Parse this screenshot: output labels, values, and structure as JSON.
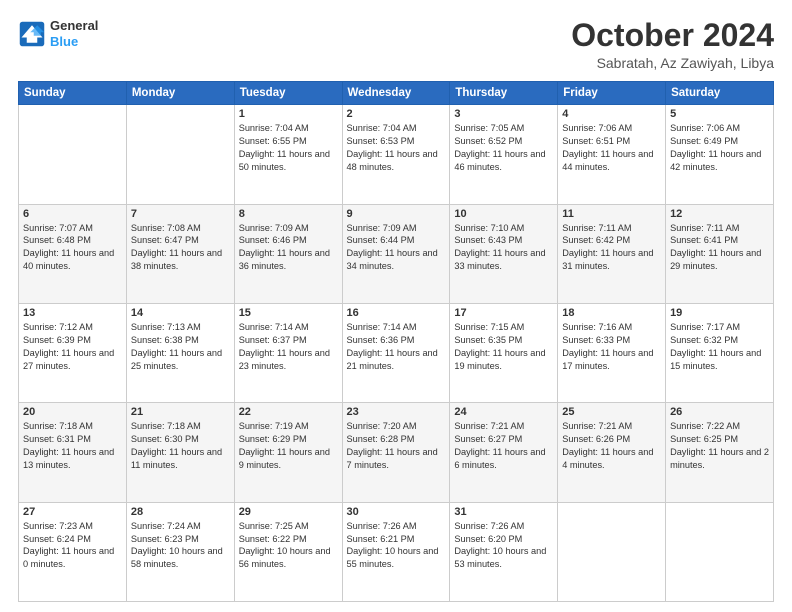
{
  "logo": {
    "line1": "General",
    "line2": "Blue"
  },
  "title": "October 2024",
  "subtitle": "Sabratah, Az Zawiyah, Libya",
  "days_header": [
    "Sunday",
    "Monday",
    "Tuesday",
    "Wednesday",
    "Thursday",
    "Friday",
    "Saturday"
  ],
  "weeks": [
    [
      {
        "day": "",
        "info": ""
      },
      {
        "day": "",
        "info": ""
      },
      {
        "day": "1",
        "info": "Sunrise: 7:04 AM\nSunset: 6:55 PM\nDaylight: 11 hours and 50 minutes."
      },
      {
        "day": "2",
        "info": "Sunrise: 7:04 AM\nSunset: 6:53 PM\nDaylight: 11 hours and 48 minutes."
      },
      {
        "day": "3",
        "info": "Sunrise: 7:05 AM\nSunset: 6:52 PM\nDaylight: 11 hours and 46 minutes."
      },
      {
        "day": "4",
        "info": "Sunrise: 7:06 AM\nSunset: 6:51 PM\nDaylight: 11 hours and 44 minutes."
      },
      {
        "day": "5",
        "info": "Sunrise: 7:06 AM\nSunset: 6:49 PM\nDaylight: 11 hours and 42 minutes."
      }
    ],
    [
      {
        "day": "6",
        "info": "Sunrise: 7:07 AM\nSunset: 6:48 PM\nDaylight: 11 hours and 40 minutes."
      },
      {
        "day": "7",
        "info": "Sunrise: 7:08 AM\nSunset: 6:47 PM\nDaylight: 11 hours and 38 minutes."
      },
      {
        "day": "8",
        "info": "Sunrise: 7:09 AM\nSunset: 6:46 PM\nDaylight: 11 hours and 36 minutes."
      },
      {
        "day": "9",
        "info": "Sunrise: 7:09 AM\nSunset: 6:44 PM\nDaylight: 11 hours and 34 minutes."
      },
      {
        "day": "10",
        "info": "Sunrise: 7:10 AM\nSunset: 6:43 PM\nDaylight: 11 hours and 33 minutes."
      },
      {
        "day": "11",
        "info": "Sunrise: 7:11 AM\nSunset: 6:42 PM\nDaylight: 11 hours and 31 minutes."
      },
      {
        "day": "12",
        "info": "Sunrise: 7:11 AM\nSunset: 6:41 PM\nDaylight: 11 hours and 29 minutes."
      }
    ],
    [
      {
        "day": "13",
        "info": "Sunrise: 7:12 AM\nSunset: 6:39 PM\nDaylight: 11 hours and 27 minutes."
      },
      {
        "day": "14",
        "info": "Sunrise: 7:13 AM\nSunset: 6:38 PM\nDaylight: 11 hours and 25 minutes."
      },
      {
        "day": "15",
        "info": "Sunrise: 7:14 AM\nSunset: 6:37 PM\nDaylight: 11 hours and 23 minutes."
      },
      {
        "day": "16",
        "info": "Sunrise: 7:14 AM\nSunset: 6:36 PM\nDaylight: 11 hours and 21 minutes."
      },
      {
        "day": "17",
        "info": "Sunrise: 7:15 AM\nSunset: 6:35 PM\nDaylight: 11 hours and 19 minutes."
      },
      {
        "day": "18",
        "info": "Sunrise: 7:16 AM\nSunset: 6:33 PM\nDaylight: 11 hours and 17 minutes."
      },
      {
        "day": "19",
        "info": "Sunrise: 7:17 AM\nSunset: 6:32 PM\nDaylight: 11 hours and 15 minutes."
      }
    ],
    [
      {
        "day": "20",
        "info": "Sunrise: 7:18 AM\nSunset: 6:31 PM\nDaylight: 11 hours and 13 minutes."
      },
      {
        "day": "21",
        "info": "Sunrise: 7:18 AM\nSunset: 6:30 PM\nDaylight: 11 hours and 11 minutes."
      },
      {
        "day": "22",
        "info": "Sunrise: 7:19 AM\nSunset: 6:29 PM\nDaylight: 11 hours and 9 minutes."
      },
      {
        "day": "23",
        "info": "Sunrise: 7:20 AM\nSunset: 6:28 PM\nDaylight: 11 hours and 7 minutes."
      },
      {
        "day": "24",
        "info": "Sunrise: 7:21 AM\nSunset: 6:27 PM\nDaylight: 11 hours and 6 minutes."
      },
      {
        "day": "25",
        "info": "Sunrise: 7:21 AM\nSunset: 6:26 PM\nDaylight: 11 hours and 4 minutes."
      },
      {
        "day": "26",
        "info": "Sunrise: 7:22 AM\nSunset: 6:25 PM\nDaylight: 11 hours and 2 minutes."
      }
    ],
    [
      {
        "day": "27",
        "info": "Sunrise: 7:23 AM\nSunset: 6:24 PM\nDaylight: 11 hours and 0 minutes."
      },
      {
        "day": "28",
        "info": "Sunrise: 7:24 AM\nSunset: 6:23 PM\nDaylight: 10 hours and 58 minutes."
      },
      {
        "day": "29",
        "info": "Sunrise: 7:25 AM\nSunset: 6:22 PM\nDaylight: 10 hours and 56 minutes."
      },
      {
        "day": "30",
        "info": "Sunrise: 7:26 AM\nSunset: 6:21 PM\nDaylight: 10 hours and 55 minutes."
      },
      {
        "day": "31",
        "info": "Sunrise: 7:26 AM\nSunset: 6:20 PM\nDaylight: 10 hours and 53 minutes."
      },
      {
        "day": "",
        "info": ""
      },
      {
        "day": "",
        "info": ""
      }
    ]
  ]
}
